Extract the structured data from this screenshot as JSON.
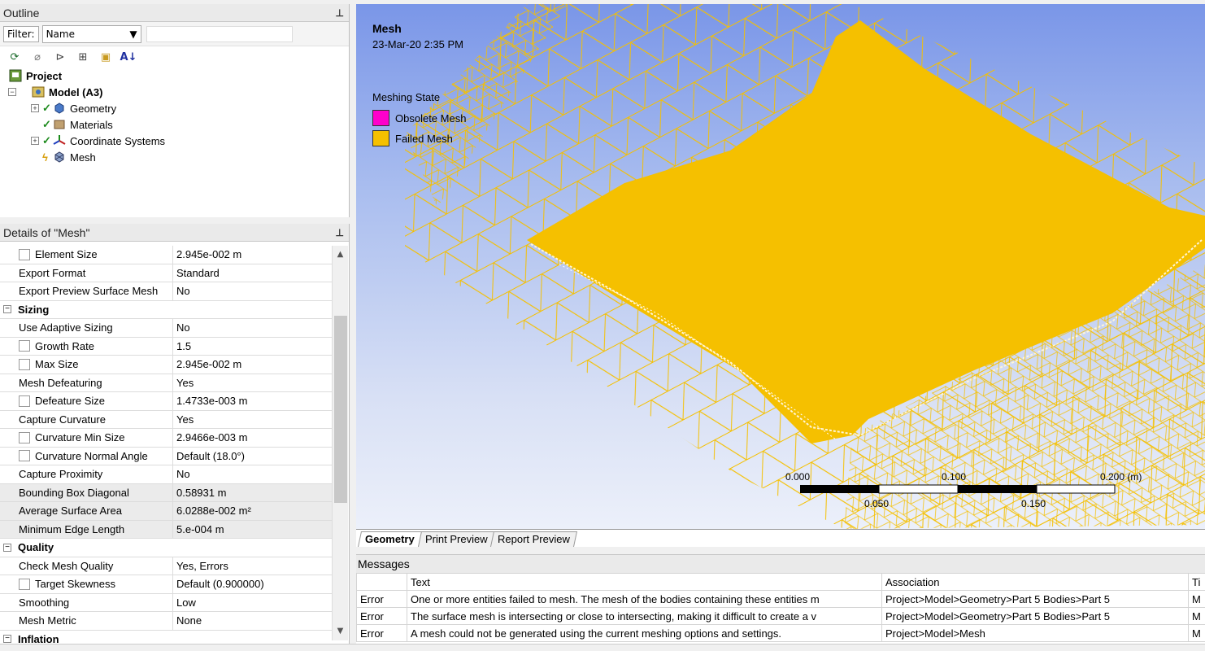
{
  "outline": {
    "title": "Outline",
    "filter_label": "Filter:",
    "filter_value": "Name",
    "tree": {
      "project": "Project",
      "model": "Model (A3)",
      "geometry": "Geometry",
      "materials": "Materials",
      "coordinate_systems": "Coordinate Systems",
      "mesh": "Mesh"
    }
  },
  "details": {
    "title": "Details of \"Mesh\"",
    "rows": [
      {
        "name": "Element Size",
        "value": "2.945e-002 m",
        "check": true
      },
      {
        "name": "Export Format",
        "value": "Standard"
      },
      {
        "name": "Export Preview Surface Mesh",
        "value": "No"
      },
      {
        "section": "Sizing"
      },
      {
        "name": "Use Adaptive Sizing",
        "value": "No"
      },
      {
        "name": "Growth Rate",
        "value": "1.5",
        "check": true
      },
      {
        "name": "Max Size",
        "value": "2.945e-002 m",
        "check": true
      },
      {
        "name": "Mesh Defeaturing",
        "value": "Yes"
      },
      {
        "name": "Defeature Size",
        "value": "1.4733e-003 m",
        "check": true
      },
      {
        "name": "Capture Curvature",
        "value": "Yes"
      },
      {
        "name": "Curvature Min Size",
        "value": "2.9466e-003 m",
        "check": true
      },
      {
        "name": "Curvature Normal Angle",
        "value": "Default (18.0°)",
        "check": true
      },
      {
        "name": "Capture Proximity",
        "value": "No"
      },
      {
        "name": "Bounding Box Diagonal",
        "value": "0.58931 m",
        "gray": true
      },
      {
        "name": "Average Surface Area",
        "value": "6.0288e-002 m²",
        "gray": true
      },
      {
        "name": "Minimum Edge Length",
        "value": "5.e-004 m",
        "gray": true
      },
      {
        "section": "Quality"
      },
      {
        "name": "Check Mesh Quality",
        "value": "Yes, Errors"
      },
      {
        "name": "Target Skewness",
        "value": "Default (0.900000)",
        "check": true
      },
      {
        "name": "Smoothing",
        "value": "Low"
      },
      {
        "name": "Mesh Metric",
        "value": "None"
      },
      {
        "section": "Inflation"
      }
    ]
  },
  "viewport": {
    "title": "Mesh",
    "date": "23-Mar-20 2:35 PM",
    "legend_title": "Meshing State",
    "legend": [
      {
        "label": "Obsolete Mesh",
        "color": "#ff00cc"
      },
      {
        "label": "Failed Mesh",
        "color": "#f5c000"
      }
    ],
    "scale": {
      "top_labels": [
        "0.000",
        "0.100",
        "0.200 (m)"
      ],
      "bottom_labels": [
        "0.050",
        "0.150"
      ]
    },
    "mesh_color": "#f5c000"
  },
  "tabs": [
    "Geometry",
    "Print Preview",
    "Report Preview"
  ],
  "messages": {
    "title": "Messages",
    "headers": [
      "",
      "Text",
      "Association",
      "Ti"
    ],
    "rows": [
      {
        "type": "Error",
        "text": "One or more entities failed to mesh. The mesh of the bodies containing these entities m",
        "assoc": "Project>Model>Geometry>Part 5 Bodies>Part 5",
        "time": "M"
      },
      {
        "type": "Error",
        "text": "The surface mesh is intersecting or close to intersecting, making it difficult to create a v",
        "assoc": "Project>Model>Geometry>Part 5 Bodies>Part 5",
        "time": "M"
      },
      {
        "type": "Error",
        "text": "A mesh could not be generated using the current meshing options and settings.",
        "assoc": "Project>Model>Mesh",
        "time": "M"
      }
    ]
  }
}
